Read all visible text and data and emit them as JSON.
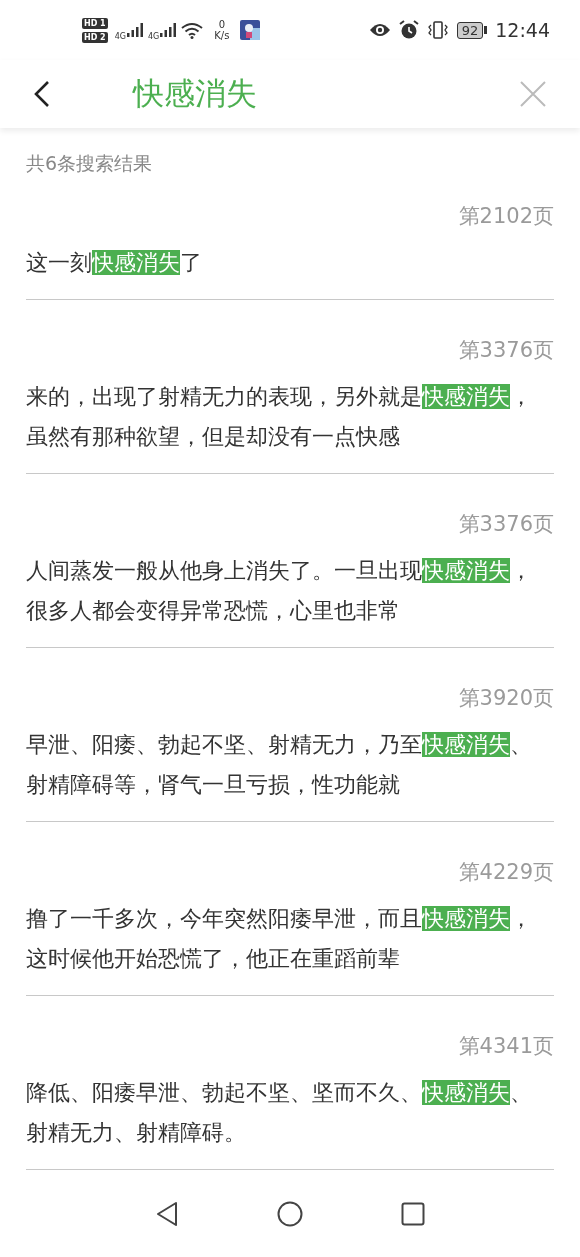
{
  "status_bar": {
    "sim_badges": [
      "HD 1",
      "HD 2"
    ],
    "networks": [
      "4G",
      "4G"
    ],
    "speed_value": "0",
    "speed_unit": "K/s",
    "battery": "92",
    "time": "12:44"
  },
  "header": {
    "title": "快感消失"
  },
  "result_count": "共6条搜索结果",
  "results": [
    {
      "page": "第2102页",
      "before": "这一刻",
      "match": "快感消失",
      "after": "了"
    },
    {
      "page": "第3376页",
      "before": "来的，出现了射精无力的表现，另外就是",
      "match": "快感消失",
      "after": "，",
      "next_line": "虽然有那种欲望，但是却没有一点快感"
    },
    {
      "page": "第3376页",
      "before": "人间蒸发一般从他身上消失了。一旦出现",
      "match": "快感消失",
      "after": "，",
      "next_line": "很多人都会变得异常恐慌，心里也非常"
    },
    {
      "page": "第3920页",
      "before": "早泄、阳痿、勃起不坚、射精无力，乃至",
      "match": "快感消失",
      "after": "、",
      "next_line": "射精障碍等，肾气一旦亏损，性功能就"
    },
    {
      "page": "第4229页",
      "before": "撸了一千多次，今年突然阳痿早泄，而且",
      "match": "快感消失",
      "after": "，",
      "next_line": "这时候他开始恐慌了，他正在重蹈前辈"
    },
    {
      "page": "第4341页",
      "before": "降低、阳痿早泄、勃起不坚、坚而不久、",
      "match": "快感消失",
      "after": "、",
      "next_line": "射精无力、射精障碍。"
    }
  ]
}
